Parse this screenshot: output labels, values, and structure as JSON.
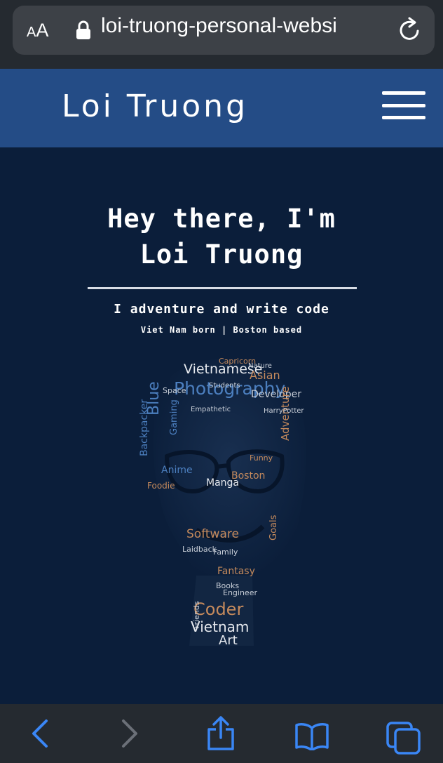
{
  "browser": {
    "text_size_label_small": "A",
    "text_size_label_big": "A",
    "url": "loi-truong-personal-websi"
  },
  "site": {
    "title": "Loi Truong",
    "menu_icon": "hamburger-icon"
  },
  "hero": {
    "title_line1": "Hey there, I'm",
    "title_line2": "Loi Truong",
    "tagline": "I adventure and write code",
    "subtagline": "Viet Nam born | Boston based"
  },
  "word_cloud": [
    {
      "text": "Vietnamese",
      "color": "#e6e9ee"
    },
    {
      "text": "Photography",
      "color": "#4c7fbf"
    },
    {
      "text": "Asian",
      "color": "#c58a5c"
    },
    {
      "text": "Developer",
      "color": "#c9cfd8"
    },
    {
      "text": "Blue",
      "color": "#4c7fbf"
    },
    {
      "text": "Adventure",
      "color": "#c58a5c"
    },
    {
      "text": "Backpacker",
      "color": "#4c7fbf"
    },
    {
      "text": "Gaming",
      "color": "#4c7fbf"
    },
    {
      "text": "Boston",
      "color": "#c58a5c"
    },
    {
      "text": "Manga",
      "color": "#e6e9ee"
    },
    {
      "text": "Anime",
      "color": "#4c7fbf"
    },
    {
      "text": "Foodie",
      "color": "#c58a5c"
    },
    {
      "text": "Software",
      "color": "#c58a5c"
    },
    {
      "text": "Laidback",
      "color": "#c9cfd8"
    },
    {
      "text": "Family",
      "color": "#c9cfd8"
    },
    {
      "text": "Fantasy",
      "color": "#c58a5c"
    },
    {
      "text": "Books",
      "color": "#c9cfd8"
    },
    {
      "text": "Coder",
      "color": "#c58a5c"
    },
    {
      "text": "Engineer",
      "color": "#c9cfd8"
    },
    {
      "text": "Friends",
      "color": "#c9cfd8"
    },
    {
      "text": "Vietnam",
      "color": "#e6e9ee"
    },
    {
      "text": "Art",
      "color": "#e6e9ee"
    },
    {
      "text": "Goals",
      "color": "#c58a5c"
    },
    {
      "text": "Capricorn",
      "color": "#c58a5c"
    },
    {
      "text": "Nature",
      "color": "#c9cfd8"
    },
    {
      "text": "Students",
      "color": "#c9cfd8"
    },
    {
      "text": "HarryPotter",
      "color": "#c9cfd8"
    },
    {
      "text": "Space",
      "color": "#c9cfd8"
    },
    {
      "text": "Funny",
      "color": "#c58a5c"
    },
    {
      "text": "Empathetic",
      "color": "#c9cfd8"
    }
  ],
  "toolbar": {
    "back_icon": "back-icon",
    "forward_icon": "forward-icon",
    "share_icon": "share-icon",
    "bookmarks_icon": "bookmarks-icon",
    "tabs_icon": "tabs-icon"
  },
  "colors": {
    "header_blue": "#244c86",
    "page_bg": "#0b1e3a",
    "browser_chrome": "#252a30",
    "toolbar_accent": "#3a86f5"
  }
}
